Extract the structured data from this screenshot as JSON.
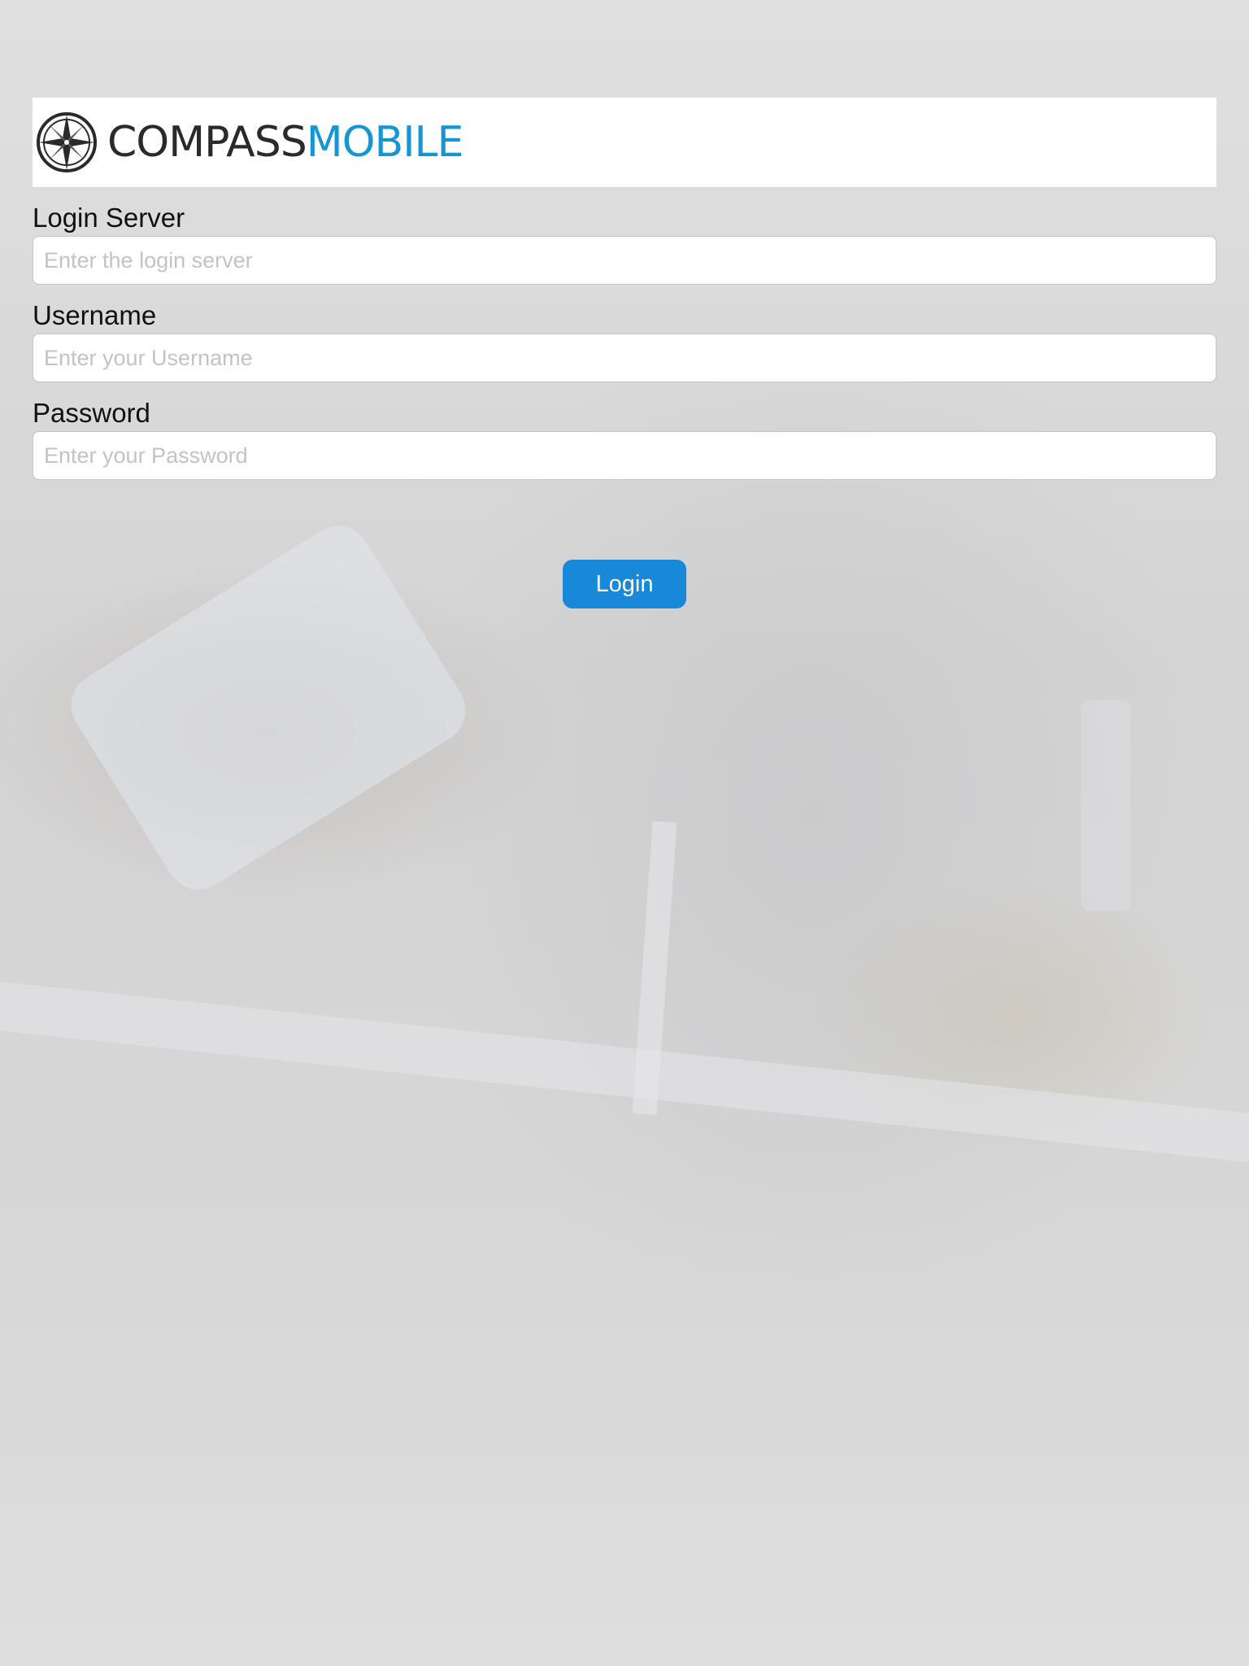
{
  "brand": {
    "name_part1": "COMPASS",
    "name_part2": "MOBILE",
    "icon": "compass-icon",
    "colors": {
      "dark": "#2a2a2a",
      "accent": "#1595d3"
    }
  },
  "form": {
    "login_server": {
      "label": "Login Server",
      "placeholder": "Enter the login server",
      "value": ""
    },
    "username": {
      "label": "Username",
      "placeholder": "Enter your Username",
      "value": ""
    },
    "password": {
      "label": "Password",
      "placeholder": "Enter your Password",
      "value": ""
    }
  },
  "actions": {
    "login_label": "Login",
    "button_color": "#1888d8"
  }
}
